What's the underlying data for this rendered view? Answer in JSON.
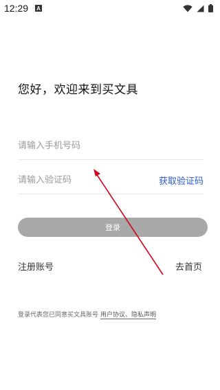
{
  "status_bar": {
    "time": "12:29"
  },
  "greeting": "您好，欢迎来到买文具",
  "phone_field": {
    "placeholder": "请输入手机号码"
  },
  "code_field": {
    "placeholder": "请输入验证码",
    "get_code_label": "获取验证码"
  },
  "login_button": {
    "label": "登录"
  },
  "links": {
    "register": "注册账号",
    "home": "去首页"
  },
  "agreement": {
    "prefix": "登录代表您已同意买文具账号",
    "terms": "用户协议、隐私声明"
  },
  "colors": {
    "accent_link": "#2b58c9",
    "annotation_arrow": "#d0021b",
    "button_bg": "#a9a9a9"
  }
}
